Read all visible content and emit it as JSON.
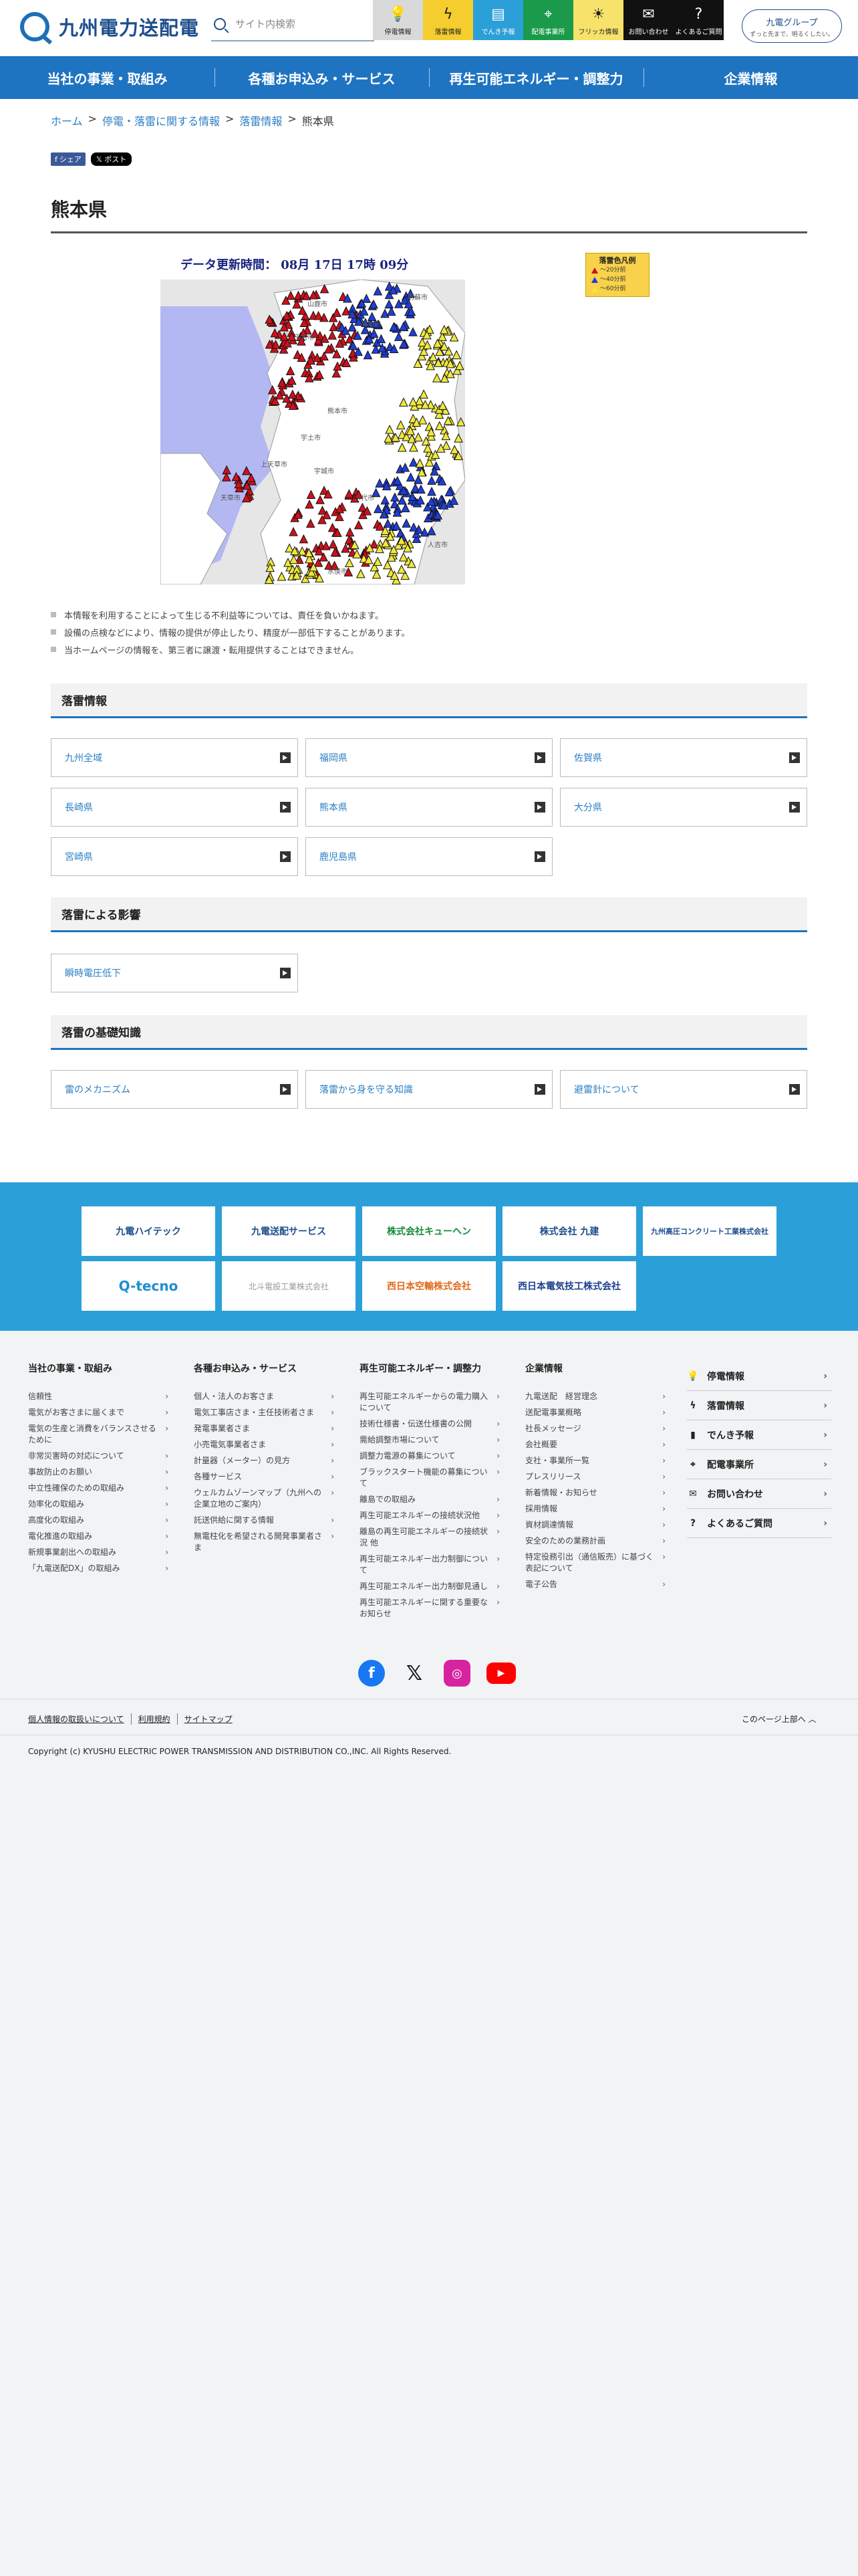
{
  "header": {
    "logo_text": "九州電力送配電",
    "search_placeholder": "サイト内検索",
    "quick_nav": [
      {
        "label": "停電情報",
        "icon": "lightbulb-icon",
        "glyph": "💡",
        "bg": "#d9d9d9",
        "color": "#222"
      },
      {
        "label": "落雷情報",
        "icon": "lightning-icon",
        "glyph": "ϟ",
        "bg": "#f5cd2e",
        "color": "#222"
      },
      {
        "label": "でんき予報",
        "icon": "gauge-icon",
        "glyph": "▤",
        "bg": "#2b9fd8",
        "color": "#fff"
      },
      {
        "label": "配電事業所",
        "icon": "map-pin-icon",
        "glyph": "⌖",
        "bg": "#1a9a4a",
        "color": "#fff"
      },
      {
        "label": "フリッカ情報",
        "icon": "flicker-bulb-icon",
        "glyph": "☀",
        "bg": "#f7e26b",
        "color": "#222"
      },
      {
        "label": "お問い合わせ",
        "icon": "mail-icon",
        "glyph": "✉",
        "bg": "#111",
        "color": "#fff"
      },
      {
        "label": "よくあるご質問",
        "icon": "question-icon",
        "glyph": "?",
        "bg": "#111",
        "color": "#fff"
      }
    ],
    "group_logo": "九電グループ",
    "group_tagline": "ずっと先まで、明るくしたい。"
  },
  "gnav": [
    "当社の事業・取組み",
    "各種お申込み・サービス",
    "再生可能エネルギー・調整力",
    "企業情報"
  ],
  "breadcrumb": {
    "items": [
      "ホーム",
      "停電・落雷に関する情報",
      "落雷情報",
      "熊本県"
    ],
    "sep": ">"
  },
  "share": {
    "facebook": "シェア",
    "x": "ポスト"
  },
  "page": {
    "title": "熊本県"
  },
  "map": {
    "update_text": "データ更新時間： 08月 17日 17時 09分",
    "legend_title": "落雷色凡例",
    "legend": [
      {
        "color": "#d0101a",
        "label": "〜20分前"
      },
      {
        "color": "#1f3fd8",
        "label": "〜40分前"
      },
      {
        "color": "#f0e83a",
        "label": "〜60分前"
      }
    ],
    "place_labels": [
      "阿蘇市",
      "菊池市",
      "山鹿市",
      "熊本市",
      "宇土市",
      "宇城市",
      "八代市",
      "水俣市",
      "人吉市",
      "天草市",
      "上天草市",
      "玉名市"
    ]
  },
  "notes": [
    "本情報を利用することによって生じる不利益等については、責任を負いかねます。",
    "設備の点検などにより、情報の提供が停止したり、精度が一部低下することがあります。",
    "当ホームページの情報を、第三者に譲渡・転用提供することはできません。"
  ],
  "sections": {
    "lightning_info": {
      "title": "落雷情報",
      "links": [
        "九州全域",
        "福岡県",
        "佐賀県",
        "長崎県",
        "熊本県",
        "大分県",
        "宮崎県",
        "鹿児島県"
      ]
    },
    "impact": {
      "title": "落雷による影響",
      "links": [
        "瞬時電圧低下"
      ]
    },
    "basics": {
      "title": "落雷の基礎知識",
      "links": [
        "雷のメカニズム",
        "落雷から身を守る知識",
        "避雷針について"
      ]
    }
  },
  "group_companies": [
    "九電ハイテック",
    "九電送配サービス",
    "株式会社キューヘン",
    "株式会社 九建",
    "九州高圧コンクリート工業株式会社",
    "Q-tecno",
    "北斗電設工業株式会社",
    "西日本空輸株式会社",
    "西日本電気技工株式会社"
  ],
  "footer": {
    "columns": [
      {
        "title": "当社の事業・取組み",
        "items": [
          "信頼性",
          "電気がお客さまに届くまで",
          "電気の生産と消費をバランスさせるために",
          "非常災害時の対応について",
          "事故防止のお願い",
          "中立性確保のための取組み",
          "効率化の取組み",
          "高度化の取組み",
          "電化推進の取組み",
          "新規事業創出への取組み",
          "「九電送配DX」の取組み"
        ]
      },
      {
        "title": "各種お申込み・サービス",
        "items": [
          "個人・法人のお客さま",
          "電気工事店さま・主任技術者さま",
          "発電事業者さま",
          "小売電気事業者さま",
          "計量器（メーター）の見方",
          "各種サービス",
          "ウェルカムゾーンマップ（九州への企業立地のご案内）",
          "託送供給に関する情報",
          "無電柱化を希望される開発事業者さま"
        ]
      },
      {
        "title": "再生可能エネルギー・調整力",
        "items": [
          "再生可能エネルギーからの電力購入について",
          "技術仕様書・伝送仕様書の公開",
          "需給調整市場について",
          "調整力電源の募集について",
          "ブラックスタート機能の募集について",
          "離島での取組み",
          "再生可能エネルギーの接続状況他",
          "離島の再生可能エネルギーの接続状況 他",
          "再生可能エネルギー出力制御について",
          "再生可能エネルギー出力制御見通し",
          "再生可能エネルギーに関する重要なお知らせ"
        ]
      },
      {
        "title": "企業情報",
        "items": [
          "九電送配　経営理念",
          "送配電事業概略",
          "社長メッセージ",
          "会社概要",
          "支社・事業所一覧",
          "プレスリリース",
          "新着情報・お知らせ",
          "採用情報",
          "資材調達情報",
          "安全のための業務計画",
          "特定役務引出（通信販売）に基づく表記について",
          "電子公告"
        ]
      }
    ],
    "side": [
      {
        "label": "停電情報",
        "glyph": "💡",
        "icon": "lightbulb-icon"
      },
      {
        "label": "落雷情報",
        "glyph": "ϟ",
        "icon": "lightning-icon"
      },
      {
        "label": "でんき予報",
        "glyph": "▮",
        "icon": "gauge-icon"
      },
      {
        "label": "配電事業所",
        "glyph": "⌖",
        "icon": "map-pin-icon"
      },
      {
        "label": "お問い合わせ",
        "glyph": "✉",
        "icon": "mail-icon"
      },
      {
        "label": "よくあるご質問",
        "glyph": "?",
        "icon": "question-icon"
      }
    ],
    "links": [
      "個人情報の取扱いについて",
      "利用規約",
      "サイトマップ"
    ],
    "to_top": "このページ上部へ",
    "copyright": "Copyright (c) KYUSHU ELECTRIC POWER TRANSMISSION AND DISTRIBUTION CO.,INC. All Rights Reserved."
  }
}
